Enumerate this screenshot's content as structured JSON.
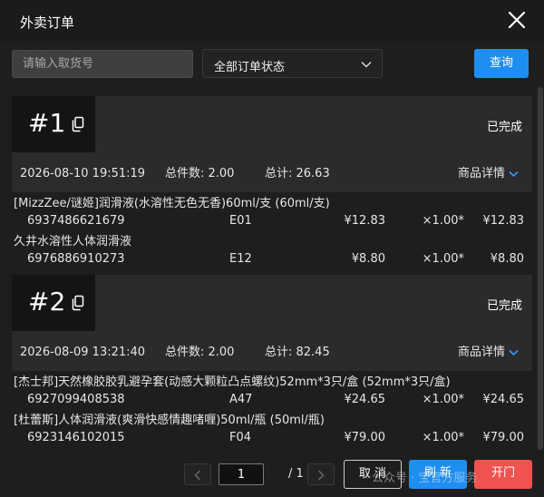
{
  "window": {
    "title": "外卖订单"
  },
  "filters": {
    "search_placeholder": "请输入取货号",
    "status_selected": "全部订单状态",
    "query_label": "查询"
  },
  "orders": [
    {
      "number": "#1",
      "status": "已完成",
      "time": "2026-08-10 19:51:19",
      "qty_text": "总件数: 2.00",
      "total_text": "总计: 26.63",
      "detail_label": "商品详情",
      "items": [
        {
          "name": "[MizzZee/谜姬]润滑液(水溶性无色无香)60ml/支 (60ml/支)",
          "code": "6937486621679",
          "location": "E01",
          "price": "¥12.83",
          "multiplier": "×1.00*",
          "total": "¥12.83"
        },
        {
          "name": "久井水溶性人体润滑液",
          "code": "6976886910273",
          "location": "E12",
          "price": "¥8.80",
          "multiplier": "×1.00*",
          "total": "¥8.80"
        }
      ]
    },
    {
      "number": "#2",
      "status": "已完成",
      "time": "2026-08-09 13:21:40",
      "qty_text": "总件数: 2.00",
      "total_text": "总计: 82.45",
      "detail_label": "商品详情",
      "items": [
        {
          "name": "[杰士邦]天然橡胶胶乳避孕套(动感大颗粒凸点螺纹)52mm*3只/盒 (52mm*3只/盒)",
          "code": "6927099408538",
          "location": "A47",
          "price": "¥24.65",
          "multiplier": "×1.00*",
          "total": "¥24.65"
        },
        {
          "name": "[杜蕾斯]人体润滑液(爽滑快感情趣啫喱)50ml/瓶 (50ml/瓶)",
          "code": "6923146102015",
          "location": "F04",
          "price": "¥79.00",
          "multiplier": "×1.00*",
          "total": "¥79.00"
        }
      ]
    }
  ],
  "pagination": {
    "current": "1",
    "separator": "/ 1"
  },
  "footer": {
    "cancel_label": "取 消",
    "refresh_label": "刷 新",
    "open_label": "开门"
  },
  "watermark": "公众号 · 宝官方服务",
  "colors": {
    "primary": "#1f8ef1",
    "danger": "#ef5350",
    "background": "#1e1e1e"
  }
}
